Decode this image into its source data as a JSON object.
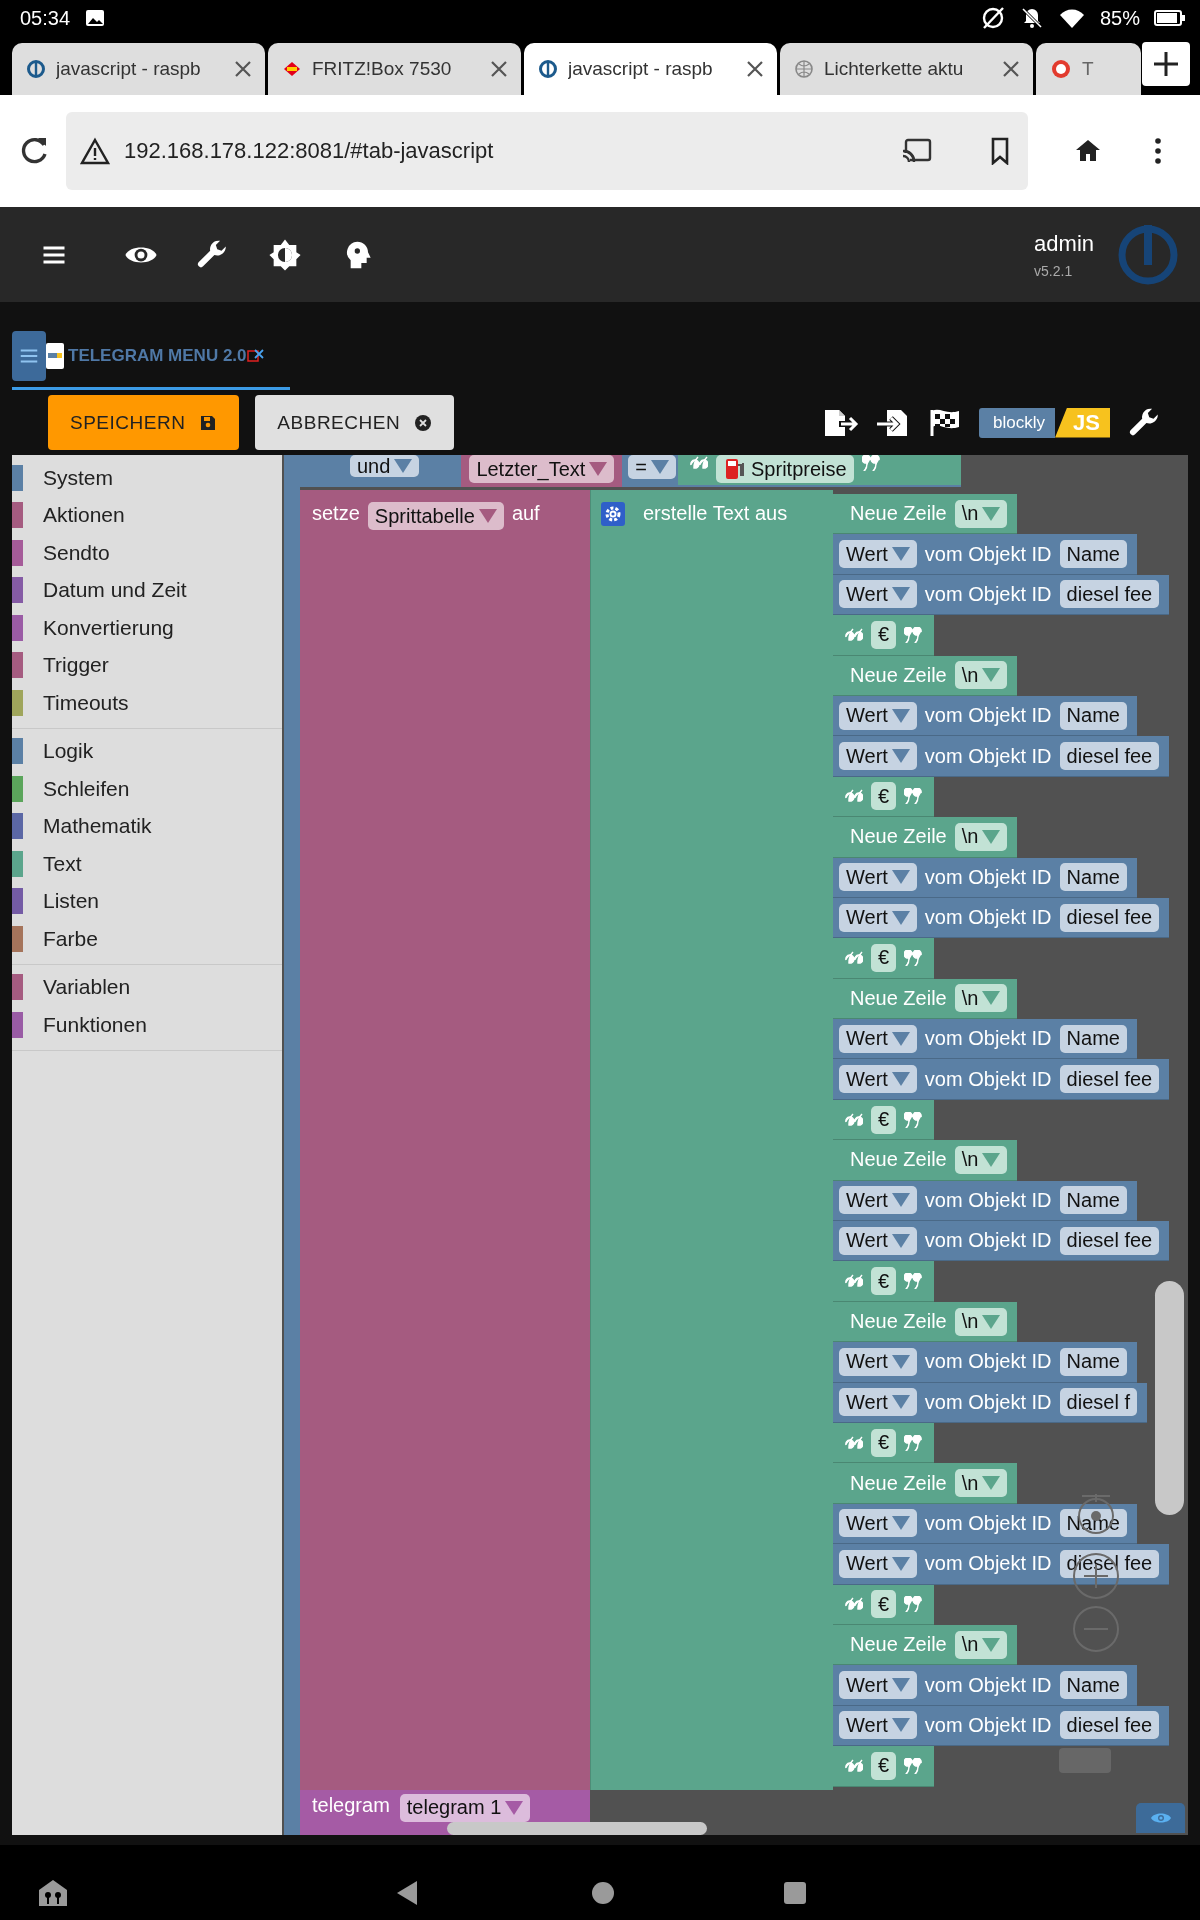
{
  "status_bar": {
    "time": "05:34",
    "battery": "85%"
  },
  "browser_tabs": [
    {
      "title": "javascript - raspb",
      "selected": false,
      "kind": "iobroker"
    },
    {
      "title": "FRITZ!Box 7530",
      "selected": false,
      "kind": "fritz"
    },
    {
      "title": "javascript - raspb",
      "selected": true,
      "kind": "iobroker"
    },
    {
      "title": "Lichterkette aktu",
      "selected": false,
      "kind": "globe"
    },
    {
      "title": "T",
      "selected": false,
      "kind": "badge"
    }
  ],
  "address_bar": {
    "url": "192.168.178.122:8081/#tab-javascript"
  },
  "app_header": {
    "user": "admin",
    "version": "v5.2.1"
  },
  "editor_tab": {
    "title": "TELEGRAM MENU 2.0"
  },
  "toolbar": {
    "buttons": [
      {
        "label": "SPEICHERN",
        "kind": "save"
      },
      {
        "label": "ABBRECHEN",
        "kind": "cancel"
      }
    ],
    "mode_switch": {
      "left": "blockly",
      "right": "JS"
    }
  },
  "sidebar": {
    "groups": [
      [
        {
          "label": "System",
          "color": "#5b80a5"
        },
        {
          "label": "Aktionen",
          "color": "#a55b80"
        },
        {
          "label": "Sendto",
          "color": "#a55b99"
        },
        {
          "label": "Datum und Zeit",
          "color": "#855ba5"
        },
        {
          "label": "Konvertierung",
          "color": "#9a5ba5"
        },
        {
          "label": "Trigger",
          "color": "#a55b80"
        },
        {
          "label": "Timeouts",
          "color": "#9fa55b"
        }
      ],
      [
        {
          "label": "Logik",
          "color": "#5b80a5"
        },
        {
          "label": "Schleifen",
          "color": "#5ba55b"
        },
        {
          "label": "Mathematik",
          "color": "#5b67a5"
        },
        {
          "label": "Text",
          "color": "#5ba58c"
        },
        {
          "label": "Listen",
          "color": "#745ba5"
        },
        {
          "label": "Farbe",
          "color": "#a5745b"
        }
      ],
      [
        {
          "label": "Variablen",
          "color": "#a55b80"
        },
        {
          "label": "Funktionen",
          "color": "#995ba5"
        }
      ]
    ]
  },
  "workspace": {
    "header": {
      "keyword": "und",
      "variable": "Letzter_Text",
      "operator": "=",
      "text": "Spritpreise"
    },
    "assign": {
      "keyword": "setze",
      "variable": "Sprittabelle",
      "to": "auf"
    },
    "join": {
      "label": "erstelle Text aus"
    },
    "items": [
      {
        "kind": "newline",
        "label": "Neue Zeile",
        "value": "\\n"
      },
      {
        "kind": "object",
        "mode": "Wert",
        "label": "vom Objekt ID",
        "id": "Name"
      },
      {
        "kind": "object",
        "mode": "Wert",
        "label": "vom Objekt ID",
        "id": "diesel  fee"
      },
      {
        "kind": "text",
        "value": "€"
      },
      {
        "kind": "newline",
        "label": "Neue Zeile",
        "value": "\\n"
      },
      {
        "kind": "object",
        "mode": "Wert",
        "label": "vom Objekt ID",
        "id": "Name"
      },
      {
        "kind": "object",
        "mode": "Wert",
        "label": "vom Objekt ID",
        "id": "diesel fee"
      },
      {
        "kind": "text",
        "value": "€"
      },
      {
        "kind": "newline",
        "label": "Neue Zeile",
        "value": "\\n"
      },
      {
        "kind": "object",
        "mode": "Wert",
        "label": "vom Objekt ID",
        "id": "Name"
      },
      {
        "kind": "object",
        "mode": "Wert",
        "label": "vom Objekt ID",
        "id": "diesel fee"
      },
      {
        "kind": "text",
        "value": "€"
      },
      {
        "kind": "newline",
        "label": "Neue Zeile",
        "value": "\\n"
      },
      {
        "kind": "object",
        "mode": "Wert",
        "label": "vom Objekt ID",
        "id": "Name"
      },
      {
        "kind": "object",
        "mode": "Wert",
        "label": "vom Objekt ID",
        "id": "diesel fee"
      },
      {
        "kind": "text",
        "value": "€"
      },
      {
        "kind": "newline",
        "label": "Neue Zeile",
        "value": "\\n"
      },
      {
        "kind": "object",
        "mode": "Wert",
        "label": "vom Objekt ID",
        "id": "Name"
      },
      {
        "kind": "object",
        "mode": "Wert",
        "label": "vom Objekt ID",
        "id": "diesel fee"
      },
      {
        "kind": "text",
        "value": "€"
      },
      {
        "kind": "newline",
        "label": "Neue Zeile",
        "value": "\\n"
      },
      {
        "kind": "object",
        "mode": "Wert",
        "label": "vom Objekt ID",
        "id": "Name"
      },
      {
        "kind": "object",
        "mode": "Wert",
        "label": "vom Objekt ID",
        "id": "diesel f"
      },
      {
        "kind": "text",
        "value": "€"
      },
      {
        "kind": "newline",
        "label": "Neue Zeile",
        "value": "\\n"
      },
      {
        "kind": "object",
        "mode": "Wert",
        "label": "vom Objekt ID",
        "id": "Name"
      },
      {
        "kind": "object",
        "mode": "Wert",
        "label": "vom Objekt ID",
        "id": "diesel fee"
      },
      {
        "kind": "text",
        "value": "€"
      },
      {
        "kind": "newline",
        "label": "Neue Zeile",
        "value": "\\n"
      },
      {
        "kind": "object",
        "mode": "Wert",
        "label": "vom Objekt ID",
        "id": "Name"
      },
      {
        "kind": "object",
        "mode": "Wert",
        "label": "vom Objekt ID",
        "id": "diesel fee"
      },
      {
        "kind": "text",
        "value": "€"
      }
    ],
    "next_block": {
      "label": "telegram",
      "instance": "telegram 1"
    }
  }
}
